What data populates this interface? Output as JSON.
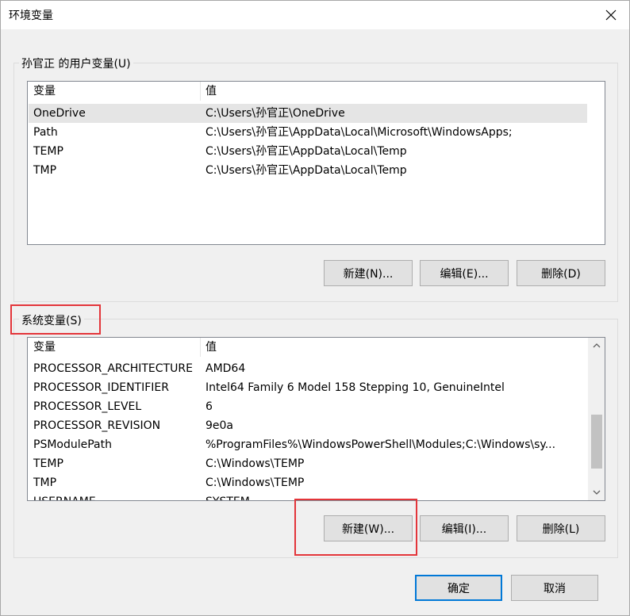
{
  "window": {
    "title": "环境变量",
    "close_icon": "close-icon"
  },
  "user_section": {
    "label": "孙官正 的用户变量(U)",
    "columns": [
      "变量",
      "值"
    ],
    "rows": [
      {
        "name": "OneDrive",
        "value": "C:\\Users\\孙官正\\OneDrive",
        "selected": true
      },
      {
        "name": "Path",
        "value": "C:\\Users\\孙官正\\AppData\\Local\\Microsoft\\WindowsApps;"
      },
      {
        "name": "TEMP",
        "value": "C:\\Users\\孙官正\\AppData\\Local\\Temp"
      },
      {
        "name": "TMP",
        "value": "C:\\Users\\孙官正\\AppData\\Local\\Temp"
      }
    ],
    "buttons": {
      "new": "新建(N)...",
      "edit": "编辑(E)...",
      "delete": "删除(D)"
    }
  },
  "system_section": {
    "label": "系统变量(S)",
    "columns": [
      "变量",
      "值"
    ],
    "rows": [
      {
        "name": "PROCESSOR_ARCHITECTURE",
        "value": "AMD64"
      },
      {
        "name": "PROCESSOR_IDENTIFIER",
        "value": "Intel64 Family 6 Model 158 Stepping 10, GenuineIntel"
      },
      {
        "name": "PROCESSOR_LEVEL",
        "value": "6"
      },
      {
        "name": "PROCESSOR_REVISION",
        "value": "9e0a"
      },
      {
        "name": "PSModulePath",
        "value": "%ProgramFiles%\\WindowsPowerShell\\Modules;C:\\Windows\\sy..."
      },
      {
        "name": "TEMP",
        "value": "C:\\Windows\\TEMP"
      },
      {
        "name": "TMP",
        "value": "C:\\Windows\\TEMP"
      },
      {
        "name": "USERNAME",
        "value": "SYSTEM"
      }
    ],
    "buttons": {
      "new": "新建(W)...",
      "edit": "编辑(I)...",
      "delete": "删除(L)"
    }
  },
  "footer": {
    "ok": "确定",
    "cancel": "取消"
  },
  "colors": {
    "highlight_box": "#e3353a",
    "default_button_border": "#0078d7"
  }
}
